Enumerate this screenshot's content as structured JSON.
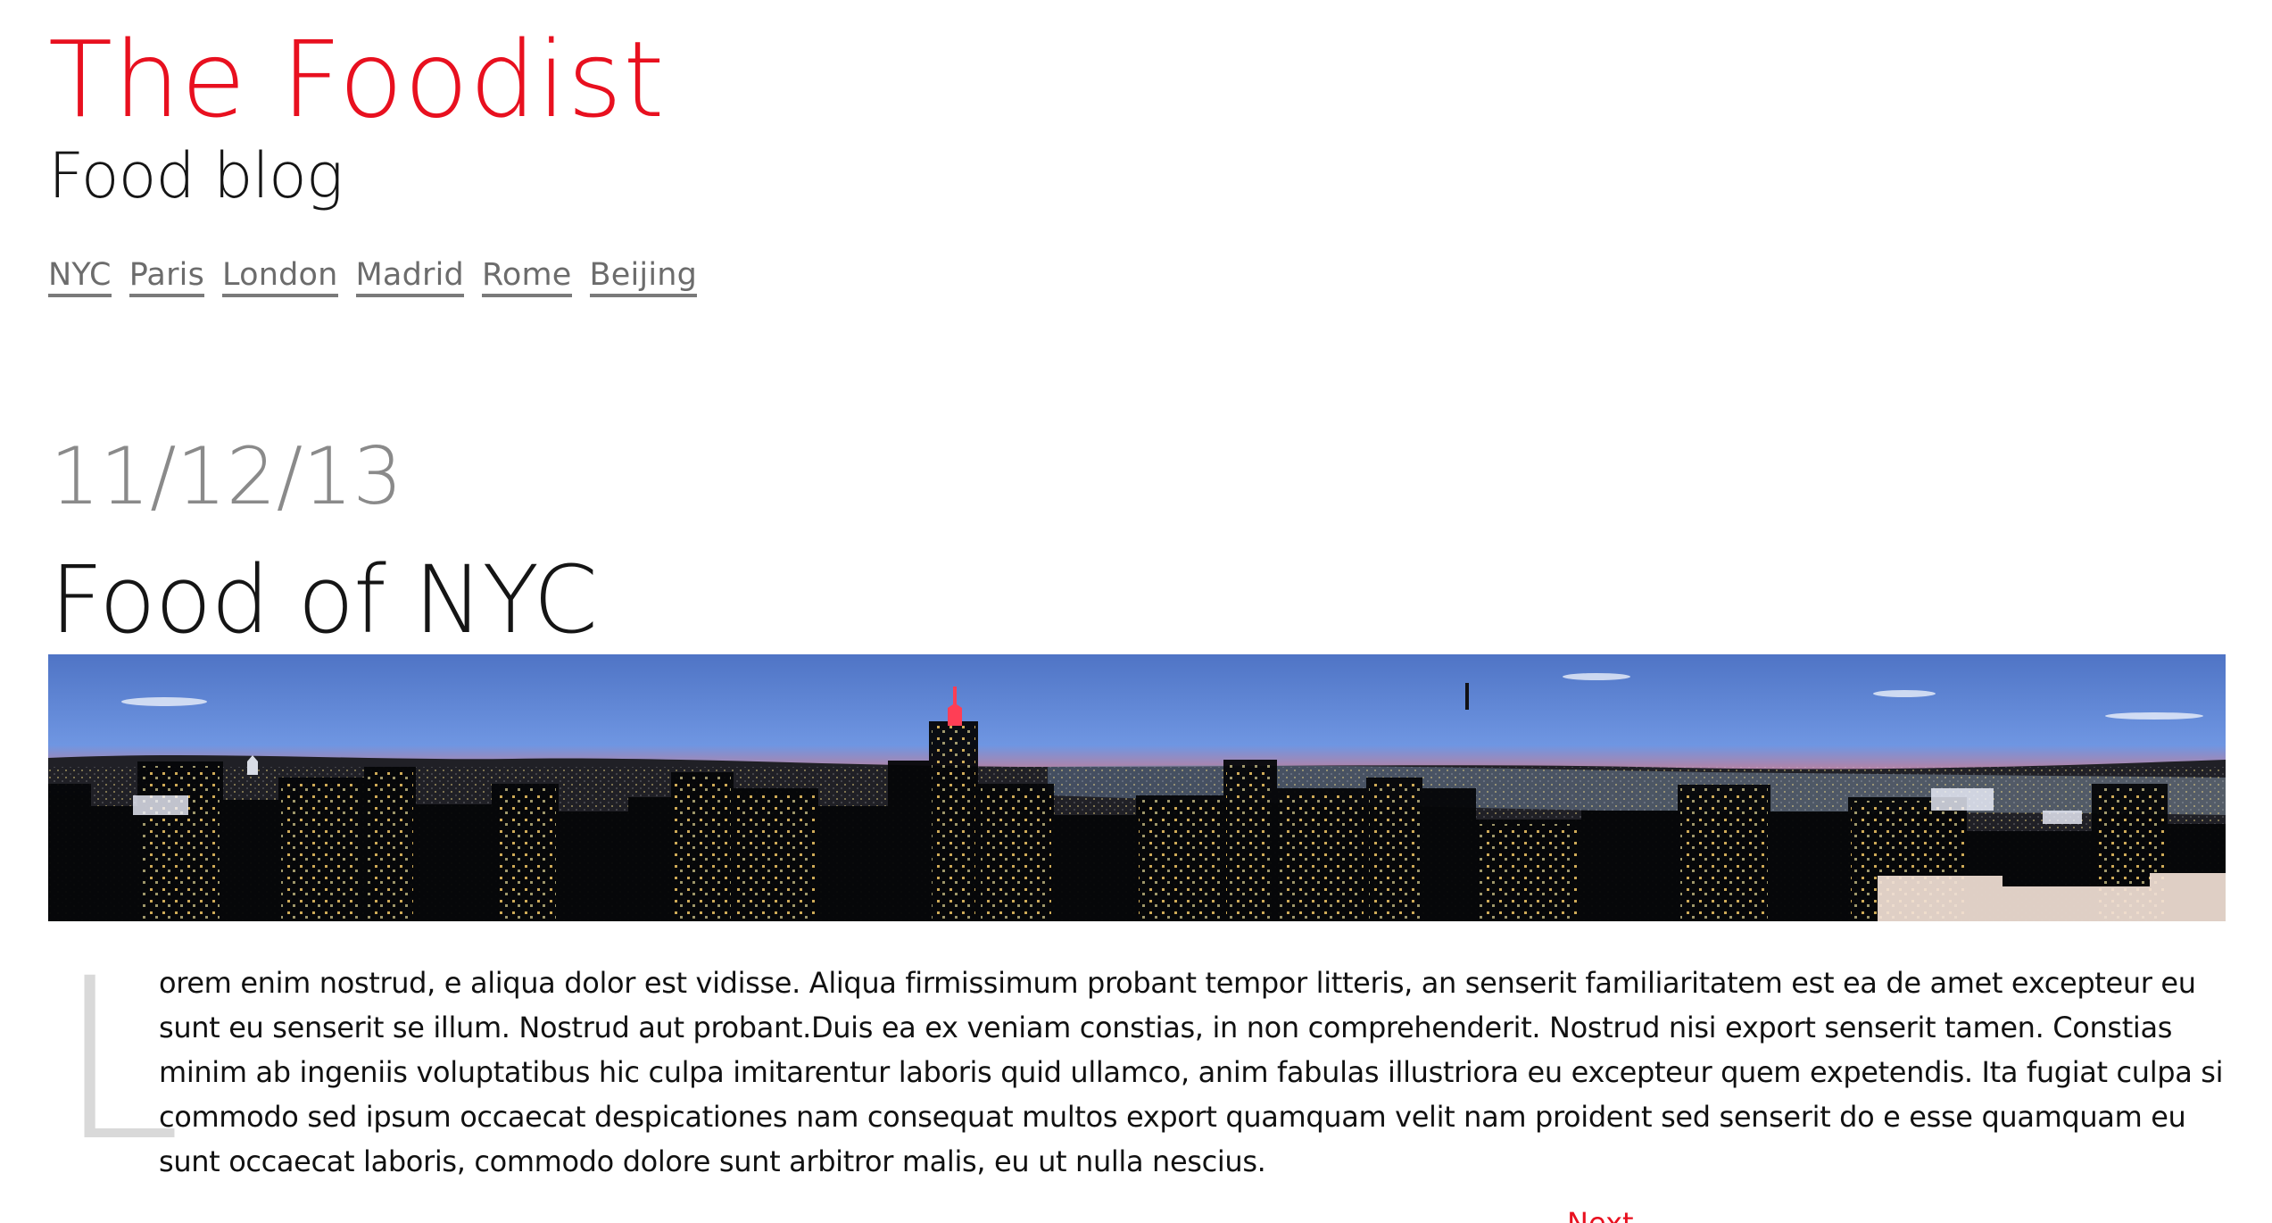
{
  "site": {
    "title": "The Foodist",
    "tagline": "Food blog",
    "nav": [
      "NYC",
      "Paris",
      "London",
      "Madrid",
      "Rome",
      "Beijing"
    ]
  },
  "post": {
    "date": "11/12/13",
    "title": "Food of NYC",
    "drop_cap": "L",
    "body": "orem enim nostrud, e aliqua dolor est vidisse. Aliqua firmissimum probant tempor litteris, an senserit familiaritatem est ea de amet excepteur eu sunt eu senserit se illum. Nostrud aut probant.Duis ea ex veniam constias, in non comprehenderit. Nostrud nisi export senserit tamen. Constias minim ab ingeniis voluptatibus hic culpa imitarentur laboris quid ullamco, anim fabulas illustriora eu excepteur quem expetendis. Ita fugiat culpa si commodo sed ipsum occaecat despicationes nam consequat multos export quamquam velit nam proident sed senserit do e esse quamquam eu sunt occaecat laboris, commodo dolore sunt arbitror malis, eu ut nulla nescius.",
    "next_label": "Next"
  },
  "colors": {
    "brand_red": "#e8101f",
    "text": "#151515",
    "muted": "#8a8a8a",
    "nav_gray": "#6c6c6c"
  },
  "icons": {
    "hero": "nyc-skyline-photo"
  }
}
